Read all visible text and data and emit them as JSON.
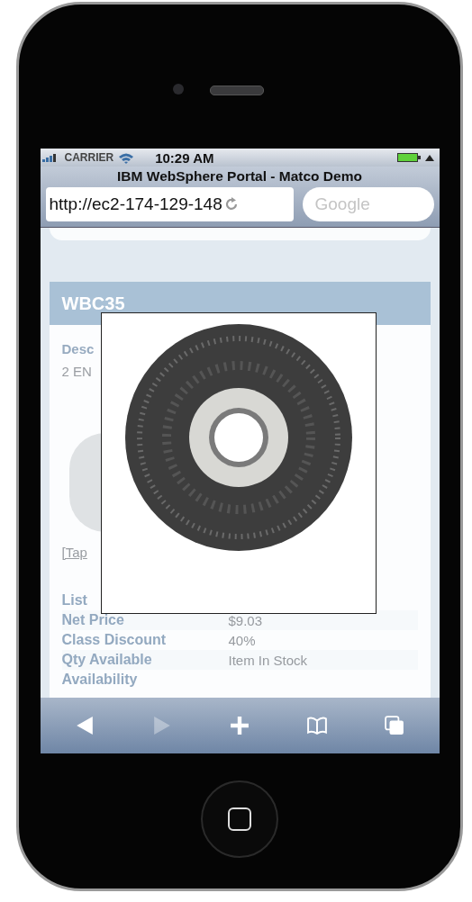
{
  "status_bar": {
    "carrier": "CARRIER",
    "time": "10:29 AM"
  },
  "browser": {
    "title": "IBM WebSphere Portal - Matco Demo",
    "url": "http://ec2-174-129-148",
    "search": {
      "placeholder": "Google"
    }
  },
  "product": {
    "code": "WBC35",
    "description_label": "Desc",
    "description": "2 EN",
    "link": "[Tap",
    "details": [
      {
        "label": "List"
      },
      {
        "label": "Net Price",
        "value": "$9.03"
      },
      {
        "label": "Class Discount",
        "value": "40%"
      },
      {
        "label": "Qty Available",
        "value": "Item In Stock"
      },
      {
        "label": "Availability"
      }
    ]
  },
  "toolbar": [
    {
      "kind": "back",
      "disabled": false
    },
    {
      "kind": "forward",
      "disabled": true
    },
    {
      "kind": "add",
      "disabled": false
    },
    {
      "kind": "bookmarks",
      "disabled": false
    },
    {
      "kind": "pages",
      "disabled": false
    }
  ]
}
